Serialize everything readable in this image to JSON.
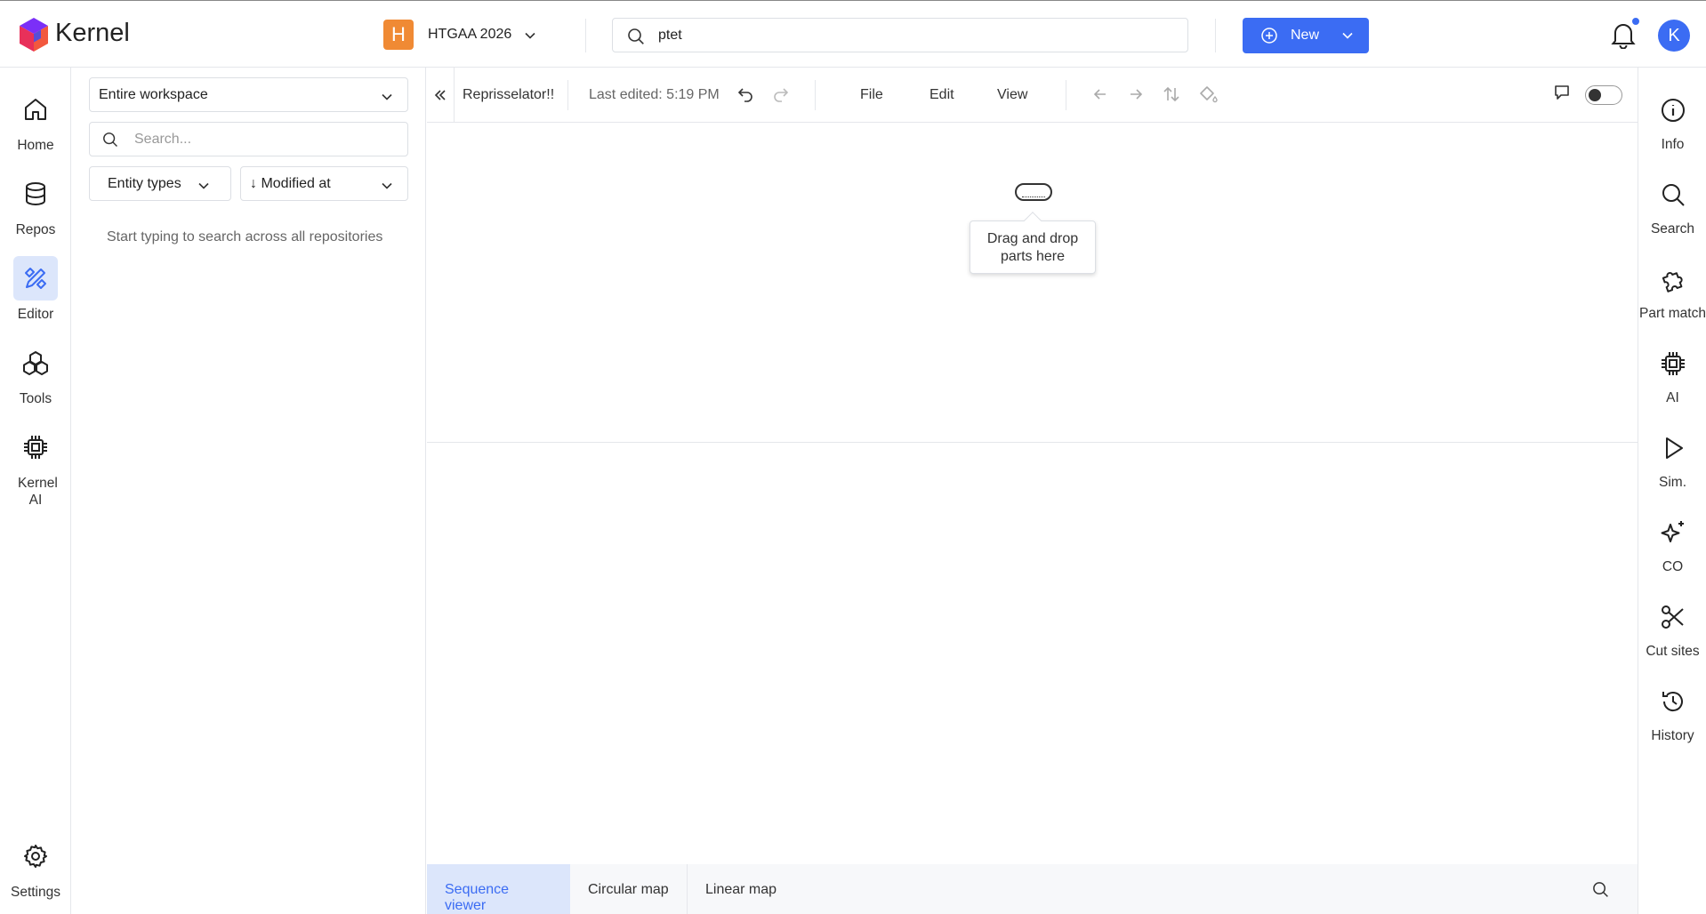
{
  "app": {
    "brand": "Kernel"
  },
  "workspace": {
    "initial": "H",
    "name": "HTGAA 2026",
    "badge_color": "#f08a34"
  },
  "search": {
    "value": "ptet"
  },
  "new_button": {
    "label": "New"
  },
  "user": {
    "initial": "K"
  },
  "accent_color": "#3b6cf3",
  "left_nav": [
    {
      "label": "Home",
      "icon": "home-icon"
    },
    {
      "label": "Repos",
      "icon": "database-icon"
    },
    {
      "label": "Editor",
      "icon": "editor-icon",
      "active": true
    },
    {
      "label": "Tools",
      "icon": "tools-icon"
    },
    {
      "label": "Kernel AI",
      "icon": "chip-icon"
    },
    {
      "label": "Settings",
      "icon": "gear-icon"
    }
  ],
  "panel": {
    "scope": "Entire workspace",
    "search_placeholder": "Search...",
    "entity_types": "Entity types",
    "sort": "↓ Modified at",
    "empty_message": "Start typing to search across all repositories"
  },
  "editor": {
    "doc_title": "Reprisselator!!",
    "last_edited": "Last edited: 5:19 PM",
    "menus": [
      "File",
      "Edit",
      "View"
    ],
    "drop_hint": "Drag and drop parts here"
  },
  "view_tabs": [
    {
      "label": "Sequence viewer",
      "active": true
    },
    {
      "label": "Circular map"
    },
    {
      "label": "Linear map"
    }
  ],
  "right_nav": [
    {
      "label": "Info",
      "icon": "info-icon"
    },
    {
      "label": "Search",
      "icon": "search-icon"
    },
    {
      "label": "Part match",
      "icon": "puzzle-icon"
    },
    {
      "label": "AI",
      "icon": "chip-icon"
    },
    {
      "label": "Sim.",
      "icon": "play-icon"
    },
    {
      "label": "CO",
      "icon": "sparkle-icon"
    },
    {
      "label": "Cut sites",
      "icon": "scissors-icon"
    },
    {
      "label": "History",
      "icon": "history-icon"
    }
  ]
}
